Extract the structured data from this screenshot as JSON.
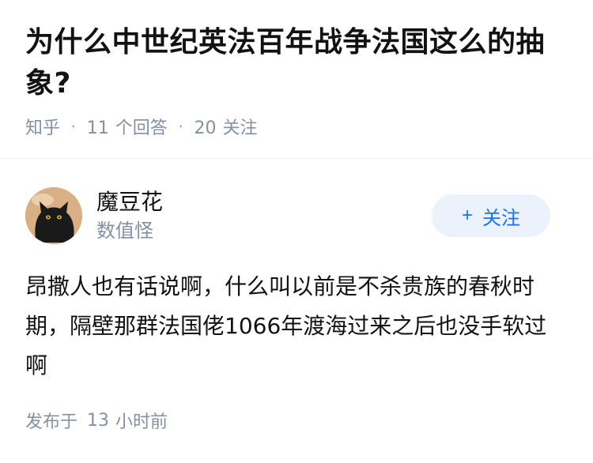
{
  "question": {
    "title": "为什么中世纪英法百年战争法国这么的抽象?",
    "source": "知乎",
    "answers_count": "11",
    "answers_label": "个回答",
    "followers_count": "20",
    "followers_label": "关注"
  },
  "author": {
    "name": "魔豆花",
    "subtitle": "数值怪",
    "avatar_icon": "black-cat-avatar",
    "follow_label": "关注"
  },
  "answer": {
    "text": "昂撒人也有话说啊，什么叫以前是不杀贵族的春秋时期，隔壁那群法国佬1066年渡海过来之后也没手软过啊"
  },
  "footer": {
    "published_label": "发布于",
    "time_value": "13",
    "time_unit": "小时前"
  },
  "colors": {
    "meta_gray": "#8590a6",
    "accent_blue": "#1772f6",
    "follow_bg": "#ebf2fb"
  }
}
